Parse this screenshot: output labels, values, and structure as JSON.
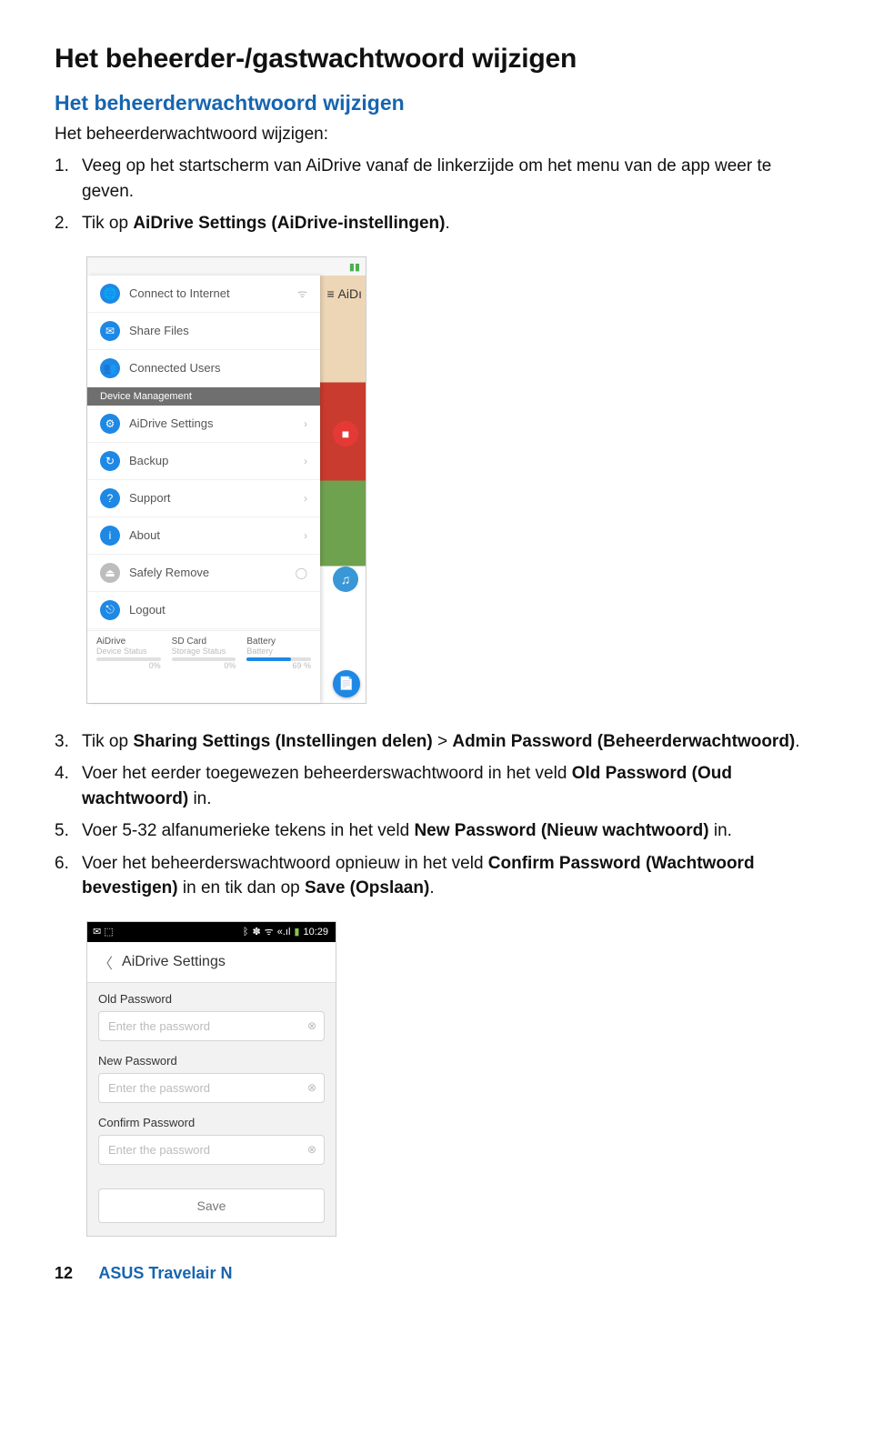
{
  "heading1": "Het beheerder-/gastwachtwoord wijzigen",
  "heading2": "Het beheerderwachtwoord wijzigen",
  "intro": "Het beheerderwachtwoord wijzigen:",
  "steps_a": [
    "Veeg op het startscherm van AiDrive vanaf de linkerzijde om het menu van de app weer te geven."
  ],
  "step2_pre": "Tik op ",
  "step2_bold": "AiDrive Settings (AiDrive-instellingen)",
  "step2_post": ".",
  "step3_pre": "Tik op ",
  "step3_bold1": "Sharing Settings (Instellingen delen)",
  "step3_mid": " > ",
  "step3_bold2": "Admin Password (Beheerderwachtwoord)",
  "step3_post": ".",
  "step4_pre": "Voer het eerder toegewezen beheerderswachtwoord in het veld ",
  "step4_bold": "Old Password (Oud wachtwoord)",
  "step4_post": " in.",
  "step5_pre": "Voer 5-32 alfanumerieke tekens in het veld ",
  "step5_bold": "New Password (Nieuw wachtwoord)",
  "step5_post": " in.",
  "step6_pre": "Voer het beheerderswachtwoord opnieuw in het veld ",
  "step6_bold1": "Confirm Password (Wachtwoord bevestigen)",
  "step6_mid": " in en tik dan op ",
  "step6_bold2": "Save (Opslaan)",
  "step6_post": ".",
  "phone1": {
    "peek_title": "AiDı",
    "items_top": [
      {
        "label": "Connect to Internet",
        "iconColor": "#1e88e5",
        "glyph": "🌐",
        "trailing": "wifi"
      },
      {
        "label": "Share Files",
        "iconColor": "#1e88e5",
        "glyph": "✉"
      },
      {
        "label": "Connected Users",
        "iconColor": "#1e88e5",
        "glyph": "👥"
      }
    ],
    "section_label": "Device Management",
    "items_mid": [
      {
        "label": "AiDrive Settings",
        "iconColor": "#1e88e5",
        "glyph": "⚙",
        "trailing": "chev"
      },
      {
        "label": "Backup",
        "iconColor": "#1e88e5",
        "glyph": "↻",
        "trailing": "chev"
      },
      {
        "label": "Support",
        "iconColor": "#1e88e5",
        "glyph": "?",
        "trailing": "chev"
      },
      {
        "label": "About",
        "iconColor": "#1e88e5",
        "glyph": "i",
        "trailing": "chev"
      },
      {
        "label": "Safely Remove",
        "iconColor": "#bdbdbd",
        "glyph": "⏏",
        "trailing": "dot"
      },
      {
        "label": "Logout",
        "iconColor": "#1e88e5",
        "glyph": "⎋"
      }
    ],
    "stats": [
      {
        "label": "AiDrive",
        "sub": "Device Status",
        "pct": 0,
        "pct_text": "0%"
      },
      {
        "label": "SD Card",
        "sub": "Storage Status",
        "pct": 0,
        "pct_text": "0%"
      },
      {
        "label": "Battery",
        "sub": "Battery",
        "pct": 69,
        "pct_text": "69 %"
      }
    ]
  },
  "phone2": {
    "time": "10:29",
    "header": "AiDrive Settings",
    "fields": [
      {
        "label": "Old Password",
        "placeholder": "Enter the password"
      },
      {
        "label": "New Password",
        "placeholder": "Enter the password"
      },
      {
        "label": "Confirm Password",
        "placeholder": "Enter the password"
      }
    ],
    "save": "Save"
  },
  "footer_page": "12",
  "footer_text": "ASUS Travelair N"
}
